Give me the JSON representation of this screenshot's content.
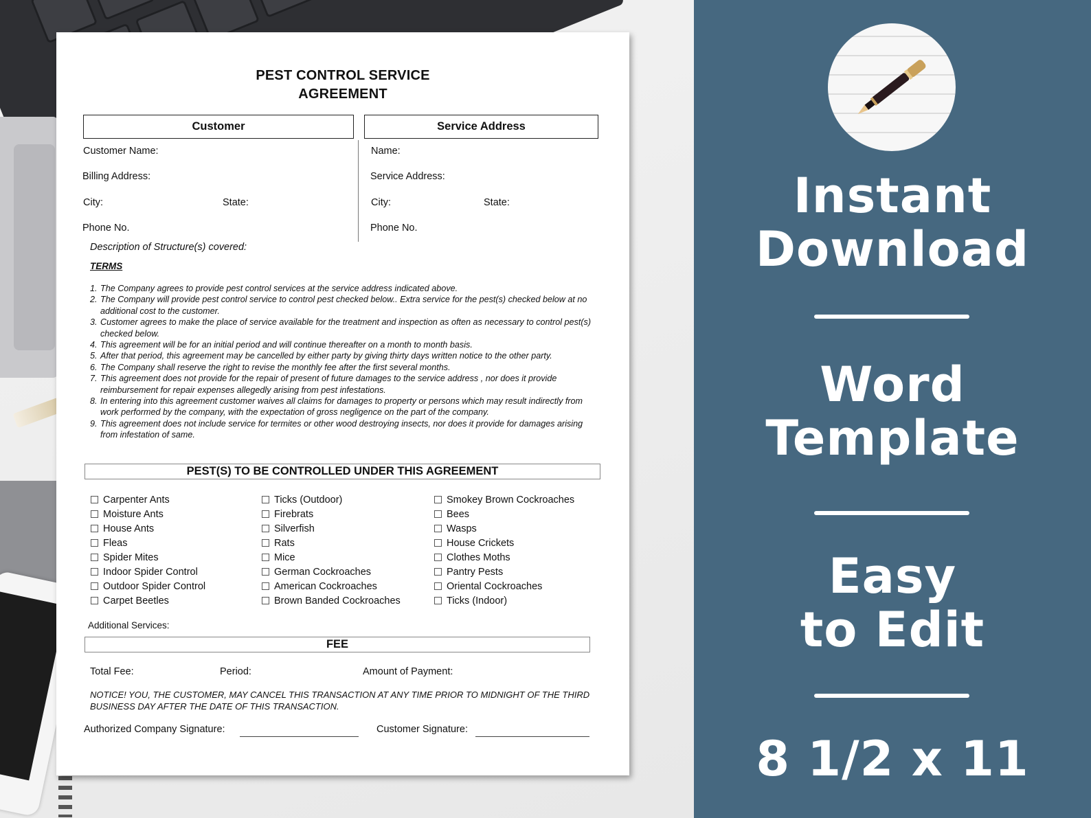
{
  "document": {
    "title_line1": "PEST CONTROL SERVICE",
    "title_line2": "AGREEMENT",
    "customer_header": "Customer",
    "service_header": "Service Address",
    "customer_fields": {
      "name": "Customer Name:",
      "billing": "Billing Address:",
      "city": "City:",
      "state": "State:",
      "phone": "Phone No."
    },
    "service_fields": {
      "name": "Name:",
      "address": "Service Address:",
      "city": "City:",
      "state": "State:",
      "phone": "Phone No."
    },
    "description_label": "Description of Structure(s) covered:",
    "terms_heading": "TERMS",
    "terms": [
      {
        "num": "1.",
        "text": "The Company agrees to provide pest control services at the service address indicated above."
      },
      {
        "num": "2.",
        "text": "The Company will provide pest control service to control pest checked below.. Extra service for the pest(s) checked below at no additional cost to the customer."
      },
      {
        "num": "3.",
        "text": "Customer agrees to make the place of service available for the treatment and inspection as often as necessary to control pest(s) checked below."
      },
      {
        "num": "4.",
        "text": "This agreement will be for an initial period and will continue thereafter on a month to month basis."
      },
      {
        "num": "5.",
        "text": "After that period, this agreement may be cancelled by either party by giving thirty days written notice to the other party."
      },
      {
        "num": "6.",
        "text": "The Company shall reserve the right to revise the monthly fee after the first several months."
      },
      {
        "num": "7.",
        "text": "This agreement does not provide for the repair of present of future damages to the service address , nor does it provide reimbursement for repair expenses allegedly arising from pest infestations."
      },
      {
        "num": "8.",
        "text": "In entering into this agreement customer waives all claims for damages to property or persons which may result indirectly from work performed by the company, with the expectation of gross negligence on the part of the company."
      },
      {
        "num": "9.",
        "text": "This agreement does not include service for termites or other wood destroying insects, nor does it provide for damages arising from infestation of same."
      }
    ],
    "pests_header": "PEST(S) TO BE CONTROLLED UNDER THIS AGREEMENT",
    "pests": [
      "Carpenter Ants",
      "Moisture Ants",
      "House Ants",
      "Fleas",
      "Spider Mites",
      "Indoor Spider Control",
      "Outdoor Spider Control",
      "Carpet Beetles",
      "Ticks (Outdoor)",
      "Firebrats",
      "Silverfish",
      "Rats",
      "Mice",
      "German Cockroaches",
      "American Cockroaches",
      "Brown Banded Cockroaches",
      "Smokey Brown Cockroaches",
      "Bees",
      "Wasps",
      "House Crickets",
      "Clothes Moths",
      "Pantry Pests",
      "Oriental Cockroaches",
      "Ticks (Indoor)"
    ],
    "additional_services_label": "Additional Services:",
    "fee_header": "FEE",
    "total_fee_label": "Total Fee:",
    "period_label": "Period:",
    "amount_label": "Amount of Payment:",
    "notice": "NOTICE! YOU, THE CUSTOMER, MAY CANCEL THIS TRANSACTION AT ANY TIME PRIOR TO MIDNIGHT OF THE THIRD BUSINESS DAY AFTER THE DATE OF THIS TRANSACTION.",
    "company_signature_label": "Authorized Company Signature:",
    "customer_signature_label": "Customer Signature:"
  },
  "promo": {
    "line1": "Instant",
    "line2": "Download",
    "line3": "Word",
    "line4": "Template",
    "line5": "Easy",
    "line6": "to Edit",
    "line7": "8 1/2 x 11",
    "logo_icon": "fountain-pen-icon",
    "panel_color": "#466880"
  }
}
